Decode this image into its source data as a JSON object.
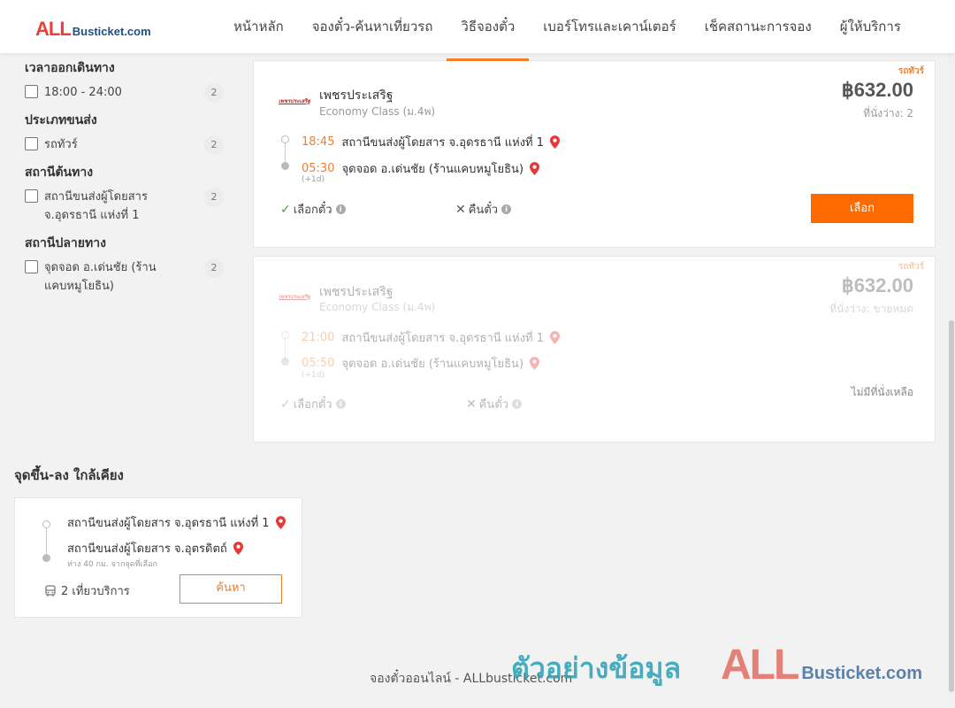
{
  "header": {
    "logo_all": "ALL",
    "logo_rest": "Busticket.com",
    "nav": [
      "หน้าหลัก",
      "จองตั๋ว-ค้นหาเที่ยวรถ",
      "วิธีจองตั๋ว",
      "เบอร์โทรและเคาน์เตอร์",
      "เช็คสถานะการจอง",
      "ผู้ให้บริการ"
    ],
    "active_nav": "วิธีจองตั๋ว"
  },
  "filters": {
    "departure_time": {
      "title": "เวลาออกเดินทาง",
      "options": [
        {
          "label": "18:00 - 24:00",
          "count": "2"
        }
      ]
    },
    "transport_type": {
      "title": "ประเภทขนส่ง",
      "options": [
        {
          "label": "รถทัวร์",
          "count": "2"
        }
      ]
    },
    "origin": {
      "title": "สถานีต้นทาง",
      "options": [
        {
          "label": "สถานีขนส่งผู้โดยสาร จ.อุดรธานี แห่งที่ 1",
          "count": "2"
        }
      ]
    },
    "destination": {
      "title": "สถานีปลายทาง",
      "options": [
        {
          "label": "จุดจอด อ.เด่นชัย (ร้านแคบหมูโยธิน)",
          "count": "2"
        }
      ]
    }
  },
  "trips": [
    {
      "tag": "รถทัวร์",
      "operator": "เพชรประเสริฐ",
      "class": "Economy Class (ม.4พ)",
      "price": "฿632.00",
      "seats": "ที่นั่งว่าง: 2",
      "dep_time": "18:45",
      "dep_station": "สถานีขนส่งผู้โดยสาร จ.อุดรธานี แห่งที่ 1",
      "arr_time": "05:30",
      "arr_station": "จุดจอด อ.เด่นชัย (ร้านแคบหมูโยธิน)",
      "next_day": "(+1d)",
      "seat_select": "เลือกตั๋ว",
      "refund": "คืนตั๋ว",
      "button": "เลือก"
    },
    {
      "tag": "รถทัวร์",
      "operator": "เพชรประเสริฐ",
      "class": "Economy Class (ม.4พ)",
      "price": "฿632.00",
      "seats": "ที่นั่งว่าง: ขายหมด",
      "dep_time": "21:00",
      "dep_station": "สถานีขนส่งผู้โดยสาร จ.อุดรธานี แห่งที่ 1",
      "arr_time": "05:50",
      "arr_station": "จุดจอด อ.เด่นชัย (ร้านแคบหมูโยธิน)",
      "next_day": "(+1d)",
      "seat_select": "เลือกตั๋ว",
      "refund": "คืนตั๋ว",
      "no_seat": "ไม่มีที่นั่งเหลือ"
    }
  ],
  "nearby": {
    "title": "จุดขึ้น-ลง ใกล้เคียง",
    "from": "สถานีขนส่งผู้โดยสาร จ.อุดรธานี แห่งที่ 1",
    "to": "สถานีขนส่งผู้โดยสาร จ.อุตรดิตถ์",
    "distance": "ห่าง 40 กม. จากจุดที่เลือก",
    "trips": "2 เที่ยวบริการ",
    "button": "ค้นหา"
  },
  "footer": {
    "text": "จองตั๋วออนไลน์ - ALLbusticket.com",
    "watermark_text": "ตัวอย่างข้อมูล",
    "watermark_all": "ALL",
    "watermark_rest": "Busticket.com"
  },
  "colors": {
    "accent": "#f47d2b",
    "button": "#ff6a00",
    "pin": "#e53935",
    "brand_red": "#e8403a",
    "brand_blue": "#1e4f86"
  }
}
